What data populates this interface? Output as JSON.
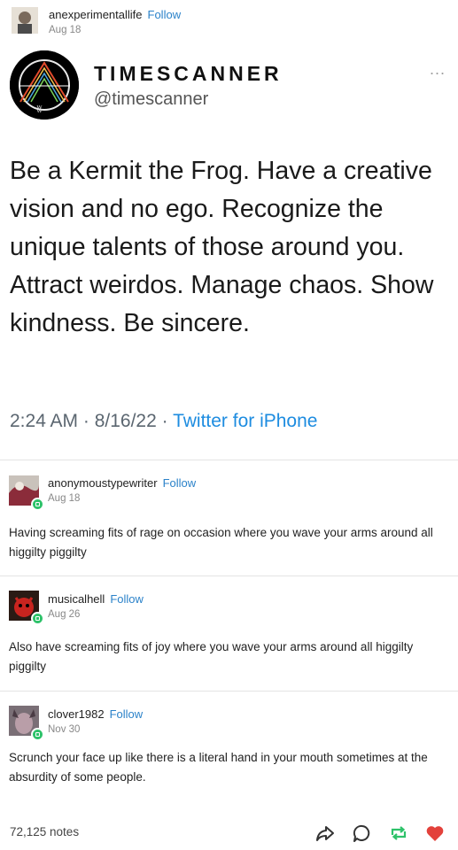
{
  "post": {
    "username": "anexperimentallife",
    "follow_label": "Follow",
    "date": "Aug 18"
  },
  "tweet": {
    "display_name": "TIMESCANNER",
    "handle": "@timescanner",
    "more_label": "...",
    "body": "Be a Kermit the Frog. Have a creative vision and no ego. Recognize the unique talents of those around you. Attract weirdos. Manage chaos. Show kindness. Be sincere.",
    "meta_time": "2:24 AM · 8/16/22 · ",
    "meta_source": "Twitter for iPhone"
  },
  "reblogs": [
    {
      "username": "anonymoustypewriter",
      "follow_label": "Follow",
      "date": "Aug 18",
      "text": "Having screaming fits of rage on occasion where you wave your arms around all higgilty piggilty"
    },
    {
      "username": "musicalhell",
      "follow_label": "Follow",
      "date": "Aug 26",
      "text": "Also have screaming fits of joy where you wave your arms around all higgilty piggilty"
    },
    {
      "username": "clover1982",
      "follow_label": "Follow",
      "date": "Nov 30",
      "text": "Scrunch your face up like there is a literal hand in your mouth sometimes at the absurdity of some people."
    }
  ],
  "footer": {
    "notes": "72,125 notes",
    "icons": [
      "share-icon",
      "reply-icon",
      "reblog-icon",
      "like-heart-icon"
    ],
    "colors": {
      "reblog": "#2ec26a",
      "like": "#e3413b"
    }
  }
}
